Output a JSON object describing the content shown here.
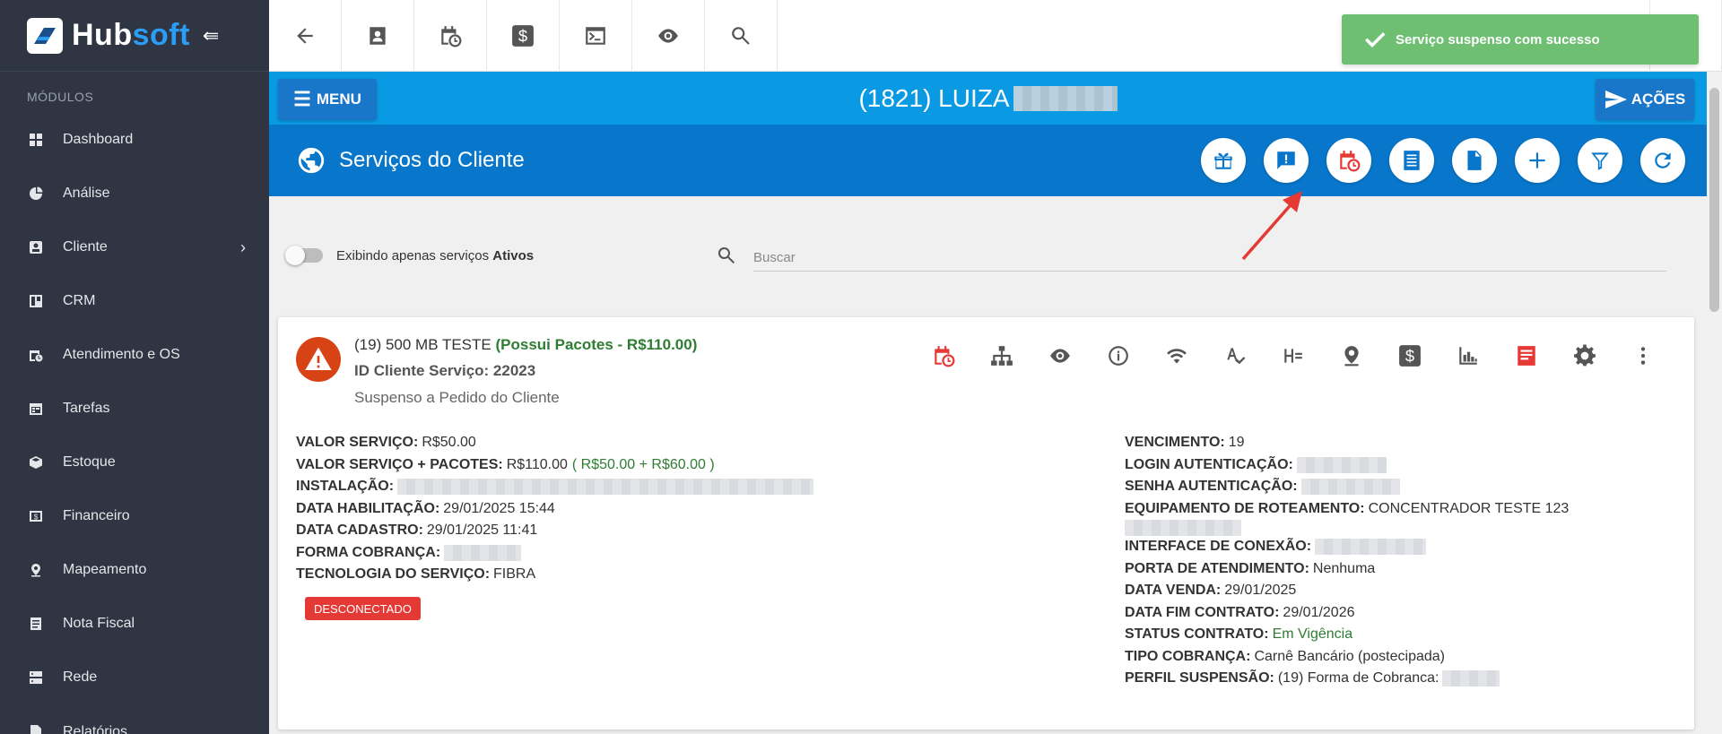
{
  "sidebar": {
    "brand_hub": "Hub",
    "brand_soft": "soft",
    "modules_label": "MÓDULOS",
    "items": [
      {
        "label": "Dashboard",
        "icon": "dashboard-icon"
      },
      {
        "label": "Análise",
        "icon": "pie-chart-icon"
      },
      {
        "label": "Cliente",
        "icon": "contact-icon",
        "has_submenu": true
      },
      {
        "label": "CRM",
        "icon": "board-icon"
      },
      {
        "label": "Atendimento e OS",
        "icon": "calendar-clock-icon"
      },
      {
        "label": "Tarefas",
        "icon": "tasks-icon"
      },
      {
        "label": "Estoque",
        "icon": "box-icon"
      },
      {
        "label": "Financeiro",
        "icon": "money-icon"
      },
      {
        "label": "Mapeamento",
        "icon": "location-icon"
      },
      {
        "label": "Nota Fiscal",
        "icon": "document-icon"
      },
      {
        "label": "Rede",
        "icon": "server-icon"
      },
      {
        "label": "Relatórios",
        "icon": "report-icon"
      }
    ]
  },
  "toast": {
    "message": "Serviço suspenso com sucesso",
    "color": "#6fbf73"
  },
  "client": {
    "menu_label": "MENU",
    "name": "(1821) LUIZA",
    "actions_label": "AÇÕES"
  },
  "services": {
    "title": "Serviços do Cliente"
  },
  "filter": {
    "toggle_label_prefix": "Exibindo apenas serviços ",
    "toggle_label_bold": "Ativos",
    "search_placeholder": "Buscar"
  },
  "service_card": {
    "name": "(19) 500 MB TESTE",
    "packages": "(Possui Pacotes - R$110.00)",
    "id_line": "ID Cliente Serviço: 22023",
    "status": "Suspenso a Pedido do Cliente",
    "badge": "DESCONECTADO",
    "left_details": [
      {
        "label": "VALOR SERVIÇO:",
        "value": "R$50.00"
      },
      {
        "label": "VALOR SERVIÇO + PACOTES:",
        "value": "R$110.00",
        "extra": "( R$50.00 + R$60.00 )"
      },
      {
        "label": "INSTALAÇÃO:",
        "value": ""
      },
      {
        "label": "DATA HABILITAÇÃO:",
        "value": "29/01/2025 15:44"
      },
      {
        "label": "DATA CADASTRO:",
        "value": "29/01/2025 11:41"
      },
      {
        "label": "FORMA COBRANÇA:",
        "value": ""
      },
      {
        "label": "TECNOLOGIA DO SERVIÇO:",
        "value": "FIBRA"
      }
    ],
    "right_details": [
      {
        "label": "VENCIMENTO:",
        "value": "19"
      },
      {
        "label": "LOGIN AUTENTICAÇÃO:",
        "value": ""
      },
      {
        "label": "SENHA AUTENTICAÇÃO:",
        "value": ""
      },
      {
        "label": "EQUIPAMENTO DE ROTEAMENTO:",
        "value": "CONCENTRADOR TESTE 123"
      },
      {
        "label": "",
        "value": ""
      },
      {
        "label": "INTERFACE DE CONEXÃO:",
        "value": ""
      },
      {
        "label": "PORTA DE ATENDIMENTO:",
        "value": "Nenhuma"
      },
      {
        "label": "DATA VENDA:",
        "value": "29/01/2025"
      },
      {
        "label": "DATA FIM CONTRATO:",
        "value": "29/01/2026"
      },
      {
        "label": "STATUS CONTRATO:",
        "value": "Em Vigência",
        "green": true
      },
      {
        "label": "TIPO COBRANÇA:",
        "value": "Carnê Bancário (postecipada)"
      },
      {
        "label": "PERFIL SUSPENSÃO:",
        "value": "(19) Forma de Cobranca:"
      }
    ]
  },
  "colors": {
    "sidebar_bg": "#2f3542",
    "client_bar": "#0a9ae3",
    "services_bar": "#0877cb",
    "accent_red": "#e53935",
    "green": "#2e7d32"
  }
}
